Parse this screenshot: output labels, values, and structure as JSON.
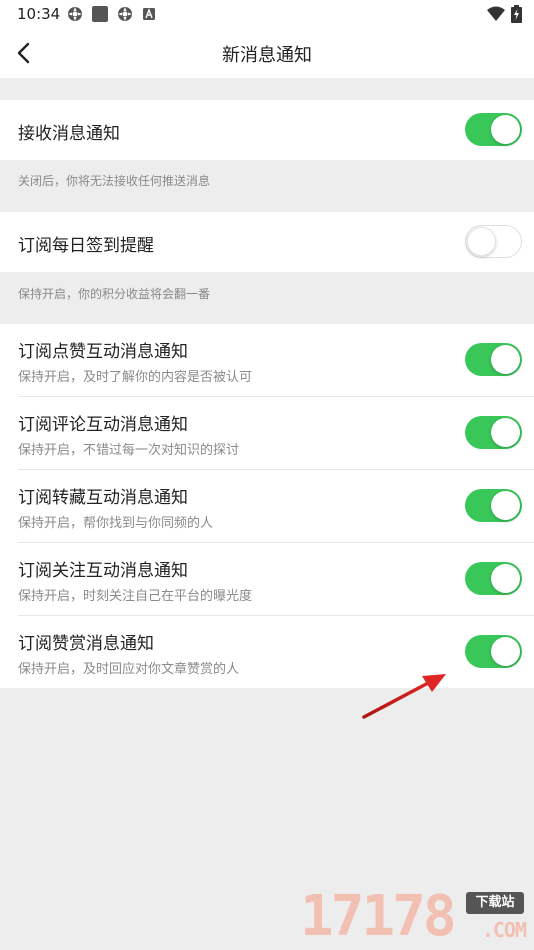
{
  "status_bar": {
    "time": "10:34",
    "left_icons": [
      "gear-icon",
      "square-icon",
      "gear-icon",
      "a-badge-icon"
    ],
    "right_icons": [
      "wifi-icon",
      "battery-icon"
    ]
  },
  "nav": {
    "title": "新消息通知",
    "back_icon": "chevron-left-icon"
  },
  "sections": [
    {
      "label": "接收消息通知",
      "enabled": true,
      "hint": "关闭后，你将无法接收任何推送消息"
    },
    {
      "label": "订阅每日签到提醒",
      "enabled": false,
      "hint": "保持开启，你的积分收益将会翻一番"
    }
  ],
  "subscriptions": [
    {
      "label": "订阅点赞互动消息通知",
      "sub": "保持开启，及时了解你的内容是否被认可",
      "enabled": true
    },
    {
      "label": "订阅评论互动消息通知",
      "sub": "保持开启，不错过每一次对知识的探讨",
      "enabled": true
    },
    {
      "label": "订阅转藏互动消息通知",
      "sub": "保持开启，帮你找到与你同频的人",
      "enabled": true
    },
    {
      "label": "订阅关注互动消息通知",
      "sub": "保持开启，时刻关注自己在平台的曝光度",
      "enabled": true
    },
    {
      "label": "订阅赞赏消息通知",
      "sub": "保持开启，及时回应对你文章赞赏的人",
      "enabled": true
    }
  ],
  "annotation": {
    "icon": "red-arrow-icon",
    "color": "#d92020"
  },
  "watermark": {
    "number": "17178",
    "badge": "下载站",
    "domain": ".COM"
  },
  "colors": {
    "toggle_on": "#3ac759",
    "background": "#ededed",
    "hint_text": "#8a8a8a"
  }
}
